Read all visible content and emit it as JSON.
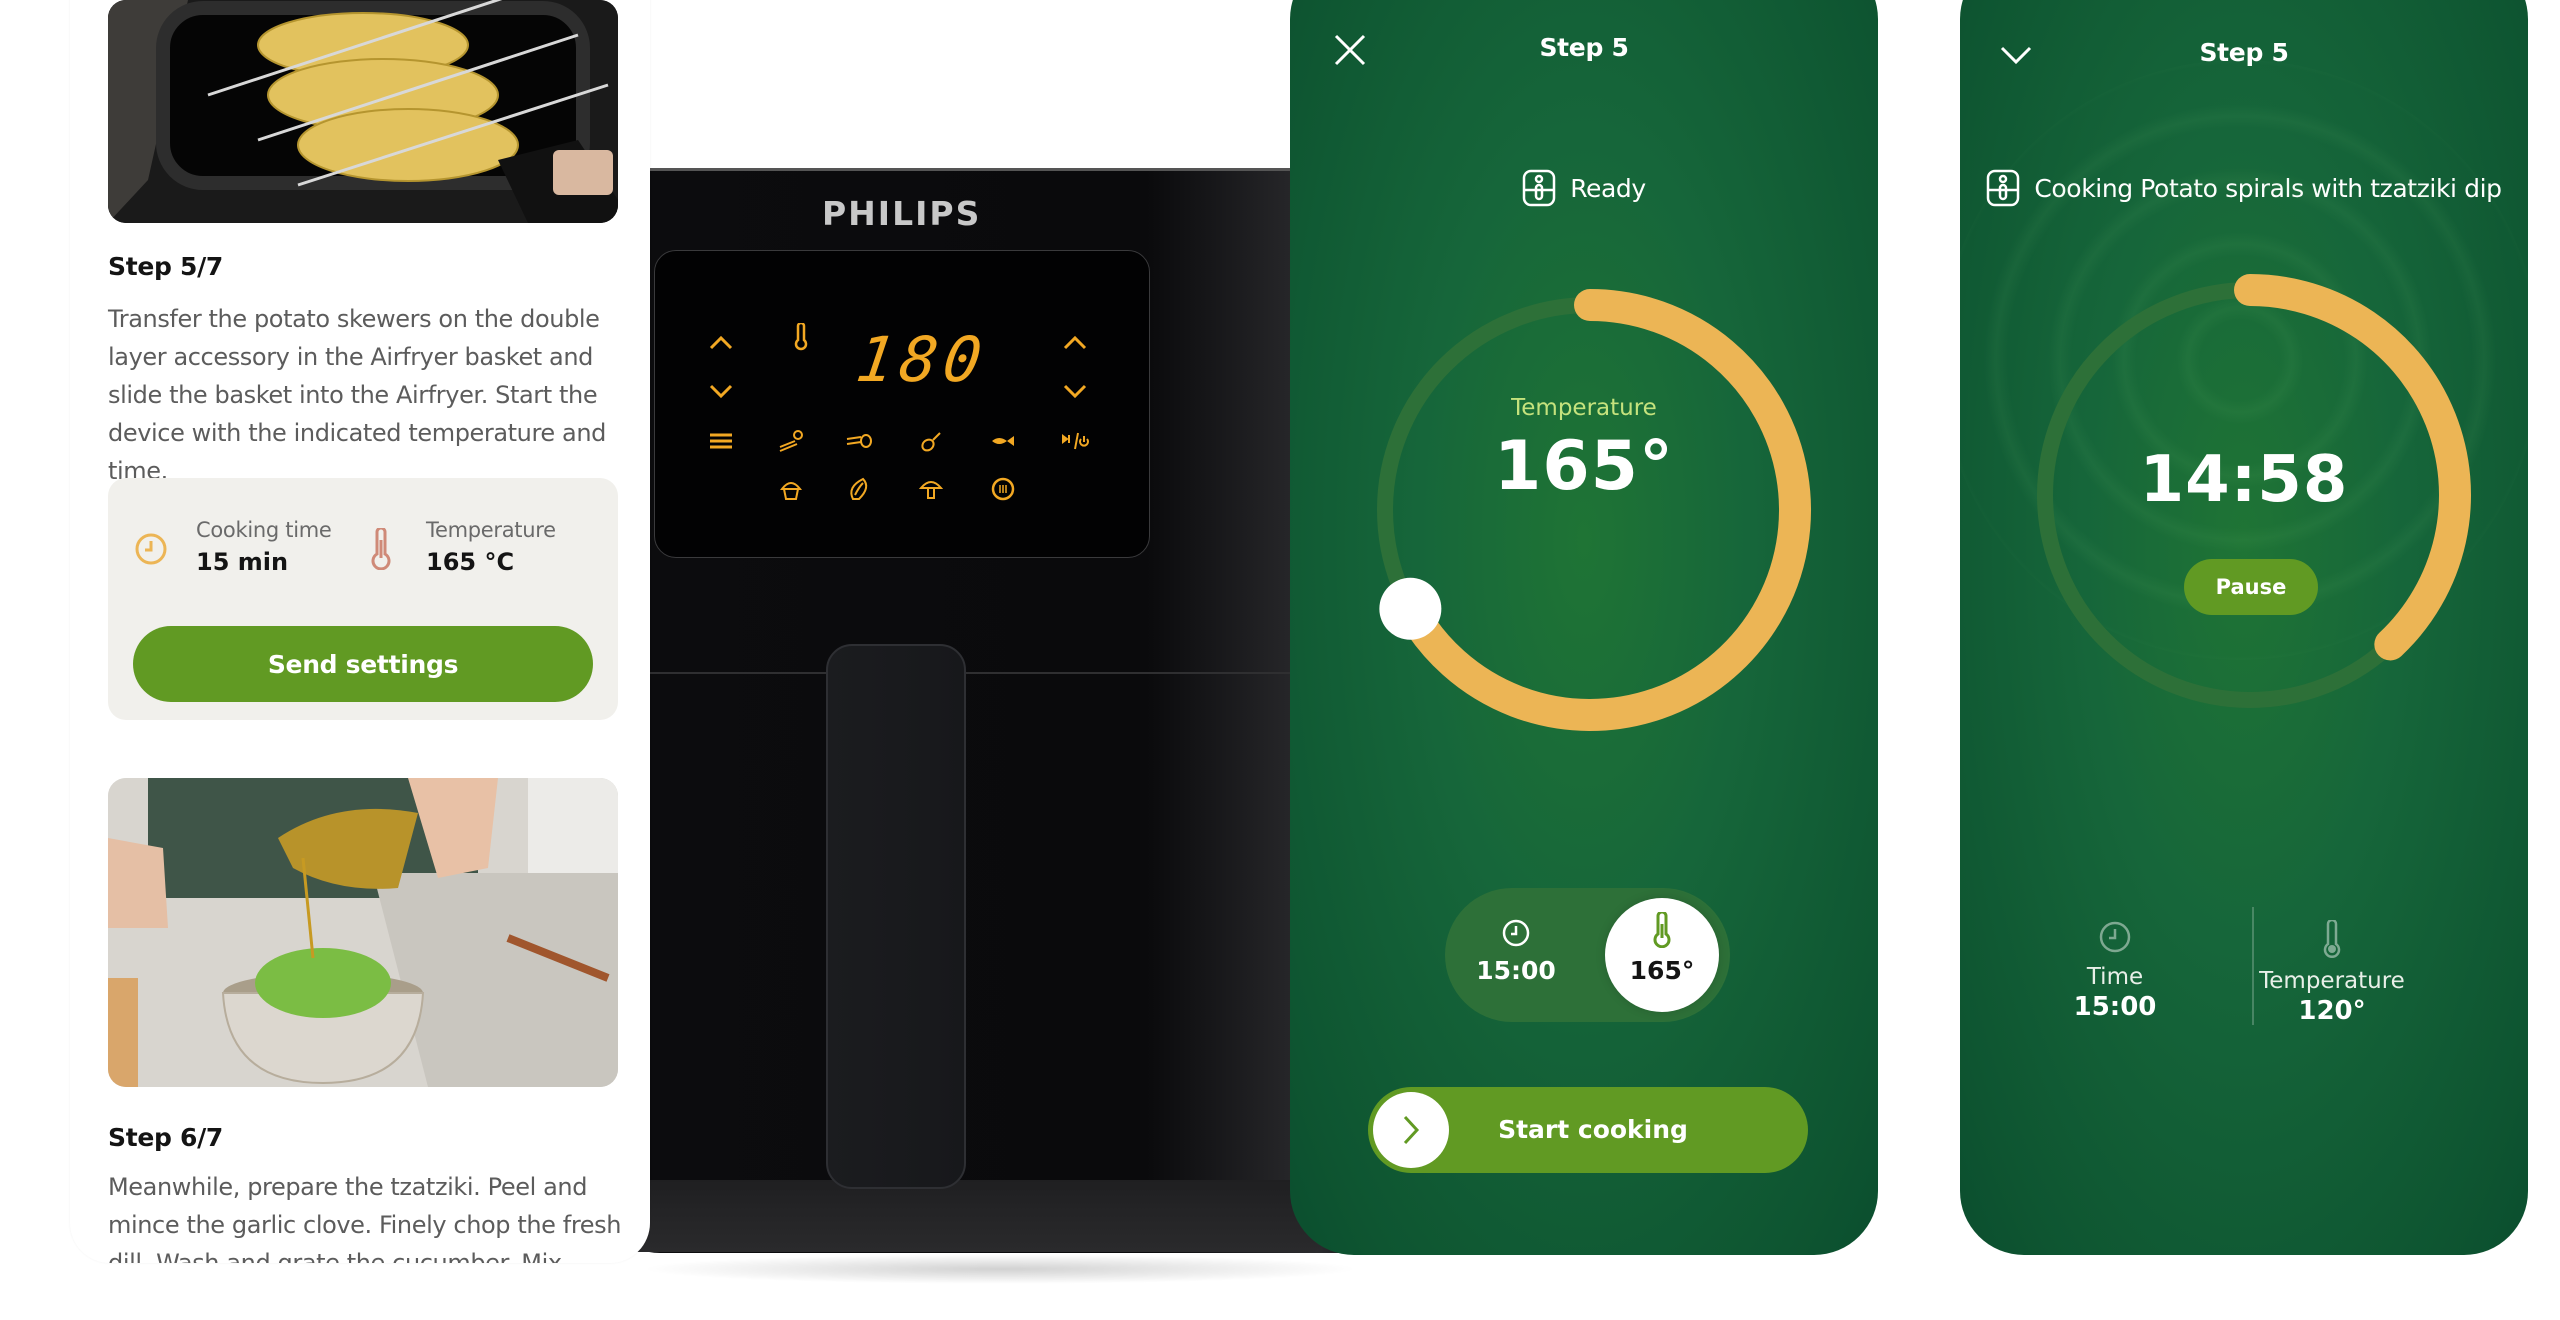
{
  "recipe": {
    "steps": [
      {
        "title": "Step 5/7",
        "text": "Transfer the potato skewers on the double layer accessory in the Airfryer basket and slide the basket into the Airfryer. Start the device with the indicated temperature and time.",
        "image_alt": "Potato skewers on double layer rack in airfryer basket"
      },
      {
        "title": "Step 6/7",
        "text": "Meanwhile, prepare the tzatziki. Peel and mince the garlic clove. Finely chop the fresh dill. Wash and grate the cucumber. Mix together",
        "image_alt": "Pouring olive oil over grated cucumber in a bowl"
      }
    ],
    "settings": {
      "cooking_time_label": "Cooking time",
      "cooking_time_value": "15 min",
      "temperature_label": "Temperature",
      "temperature_value": "165 °C",
      "send_button": "Send settings"
    }
  },
  "airfryer": {
    "brand": "PHILIPS",
    "display_value": "180",
    "panel_icons": [
      "up-arrow",
      "down-arrow",
      "thermometer",
      "up-arrow",
      "down-arrow",
      "menu",
      "frozen-snacks",
      "fries-meat",
      "drumstick",
      "fish",
      "play-pause-power",
      "muffin",
      "vegetable",
      "mushroom",
      "keep-warm"
    ]
  },
  "phone_setup": {
    "title": "Step 5",
    "status": "Ready",
    "dial_label": "Temperature",
    "dial_value": "165°",
    "dial_fraction": 0.67,
    "mode_time": "15:00",
    "mode_temp": "165°",
    "start_button": "Start cooking"
  },
  "phone_cooking": {
    "title": "Step 5",
    "status": "Cooking Potato spirals with tzatziki dip",
    "timer": "14:58",
    "timer_fraction": 0.38,
    "pause_button": "Pause",
    "time_label": "Time",
    "time_value": "15:00",
    "temp_label": "Temperature",
    "temp_value": "120°"
  },
  "colors": {
    "accent_green": "#619a23",
    "phone_green": "#16663a",
    "dial_orange": "#ecb555",
    "led_amber": "#f2a823"
  }
}
